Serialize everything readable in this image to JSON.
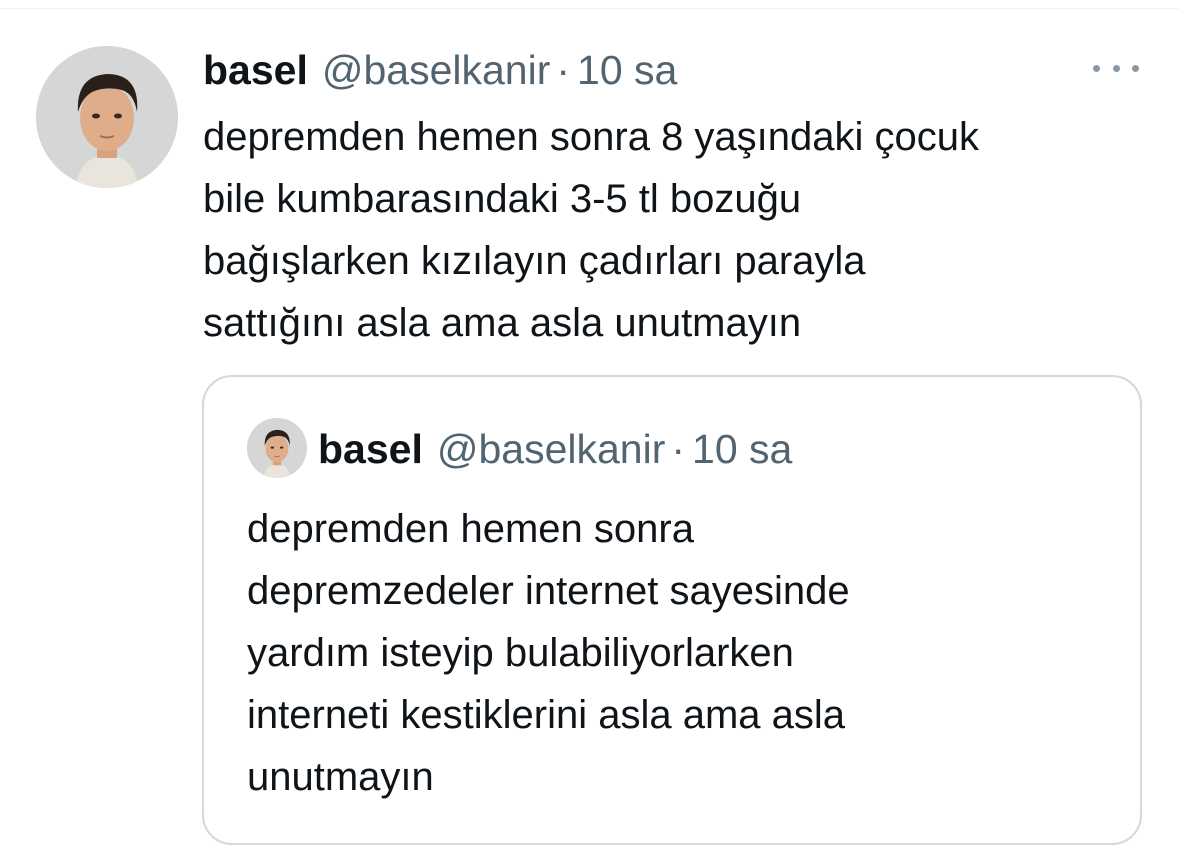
{
  "tweet": {
    "author_name": "basel",
    "author_handle": "@baselkanir",
    "separator": "·",
    "time": "10 sa",
    "more_icon": "ellipsis-icon",
    "avatar_icon": "user-avatar-photo",
    "text": "depremden hemen sonra 8 yaşındaki çocuk\nbile kumbarasındaki 3-5 tl bozuğu\nbağışlarken kızılayın çadırları parayla\nsattığını asla ama asla unutmayın"
  },
  "quoted_tweet": {
    "author_name": "basel",
    "author_handle": "@baselkanir",
    "separator": "·",
    "time": "10 sa",
    "avatar_icon": "user-avatar-photo",
    "text": "depremden hemen sonra\ndepremzedeler internet sayesinde\nyardım isteyip bulabiliyorlarken\ninterneti kestiklerini asla ama asla\nunutmayın"
  },
  "colors": {
    "text_primary": "#0f1419",
    "text_secondary": "#536471",
    "border": "#cfd9de"
  }
}
